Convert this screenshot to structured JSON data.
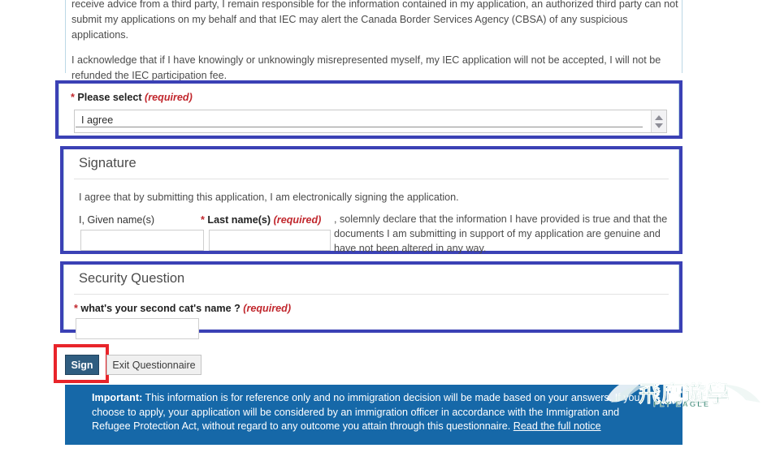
{
  "intro": {
    "paragraph1": "receive advice from a third party, I remain responsible for the information contained in my application, an authorized third party can not submit my applications on my behalf and that IEC may alert the Canada Border Services Agency (CBSA) of any suspicious applications.",
    "paragraph2": "I acknowledge that if I have knowingly or unknowingly misrepresented myself, my IEC application will not be accepted, I will not be refunded the IEC participation fee."
  },
  "please_select": {
    "label": "Please select",
    "required_tag": "(required)",
    "star": "*",
    "selected_value": "I agree"
  },
  "signature": {
    "title": "Signature",
    "agree_text": "I agree that by submitting this application, I am electronically signing the application.",
    "given_label": "I, Given name(s)",
    "last_label": "Last name(s)",
    "last_required_tag": "(required)",
    "star": "*",
    "given_value": "",
    "last_value": "",
    "declaration": ", solemnly declare that the information I have provided is true and that the documents I am submitting in support of my application are genuine and have not been altered in any way."
  },
  "security_question": {
    "title": "Security Question",
    "star": "*",
    "question": "what's your second cat's name ?",
    "required_tag": "(required)",
    "answer_value": ""
  },
  "actions": {
    "sign_label": "Sign",
    "exit_label": "Exit Questionnaire"
  },
  "banner": {
    "important_label": "Important:",
    "text": " This information is for reference only and no immigration decision will be made based on your answers. If you choose to apply, your application will be considered by an immigration officer in accordance with the Immigration and Refugee Protection Act, without regard to any outcome you attain through this questionnaire. ",
    "link_label": "Read the full notice"
  },
  "watermark": {
    "cjk": "飛鷹遊學",
    "english": "FLY EAGLE"
  },
  "colors": {
    "highlight_border": "#3b41b5",
    "focus_box": "#e8242a",
    "banner_bg": "#1668a8",
    "required_red": "#c1272d",
    "sign_button": "#2f5d80"
  }
}
